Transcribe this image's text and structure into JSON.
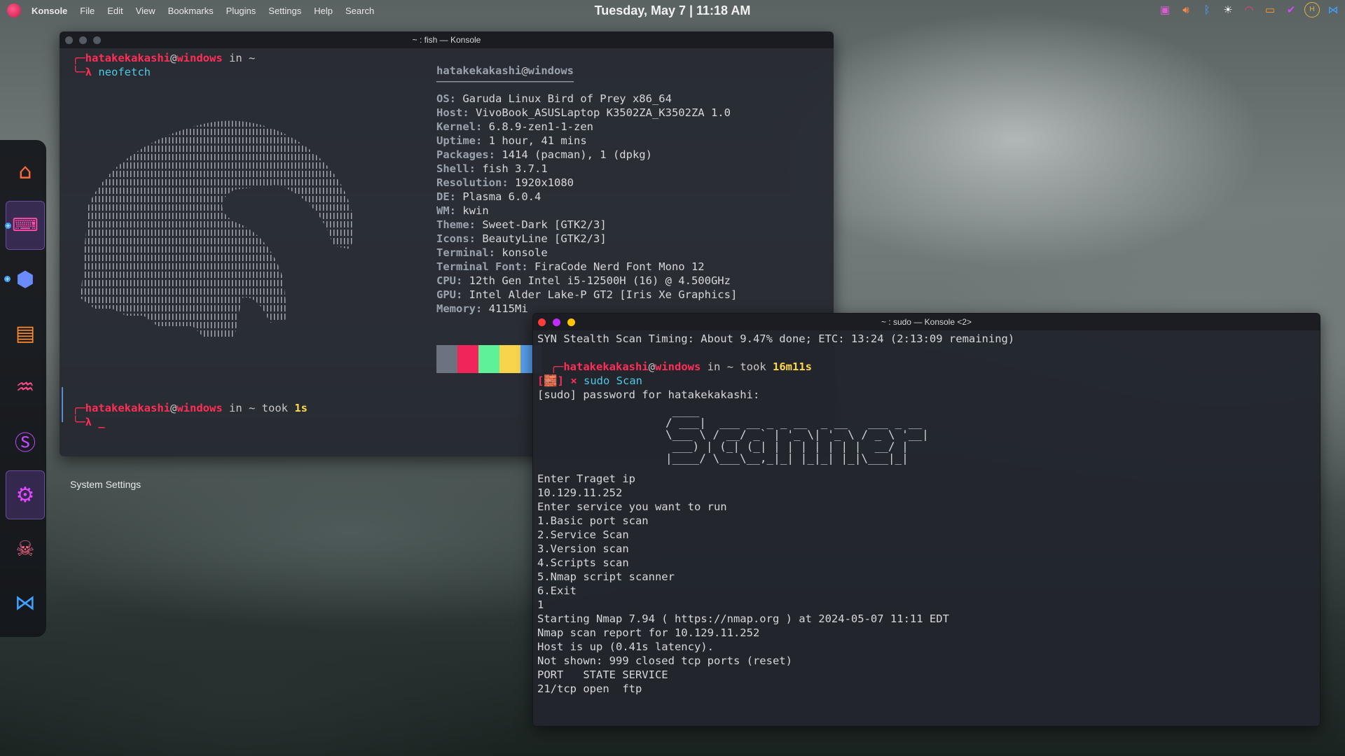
{
  "topbar": {
    "app_name": "Konsole",
    "menu": [
      "File",
      "Edit",
      "View",
      "Bookmarks",
      "Plugins",
      "Settings",
      "Help",
      "Search"
    ],
    "clock": "Tuesday, May 7 | 11:18 AM",
    "tray_icons": [
      "calendar-icon",
      "volume-icon",
      "bluetooth-icon",
      "brightness-icon",
      "wifi-icon",
      "battery-icon",
      "vivaldi-icon",
      "user-avatar-icon",
      "vscode-icon"
    ],
    "avatar_letter": "H"
  },
  "dock": {
    "items": [
      "garuda-icon",
      "konsole-icon",
      "browser-icon",
      "files-icon",
      "system-monitor-icon",
      "snap-icon",
      "settings-icon",
      "ghost-icon",
      "vscode-icon"
    ],
    "tooltip": "System Settings"
  },
  "window1": {
    "title": "~ : fish — Konsole",
    "prompt_user": "hatakekakashi",
    "prompt_at": "@",
    "prompt_host": "windows",
    "prompt_in": " in ",
    "prompt_dir": "~",
    "command": "neofetch",
    "lambda": "λ",
    "header_user": "hatakekakashi",
    "header_at": "@",
    "header_host": "windows",
    "separator": "─────────────────────",
    "info": [
      {
        "label": "OS",
        "value": "Garuda Linux Bird of Prey x86_64"
      },
      {
        "label": "Host",
        "value": "VivoBook_ASUSLaptop K3502ZA_K3502ZA 1.0"
      },
      {
        "label": "Kernel",
        "value": "6.8.9-zen1-1-zen"
      },
      {
        "label": "Uptime",
        "value": "1 hour, 41 mins"
      },
      {
        "label": "Packages",
        "value": "1414 (pacman), 1 (dpkg)"
      },
      {
        "label": "Shell",
        "value": "fish 3.7.1"
      },
      {
        "label": "Resolution",
        "value": "1920x1080"
      },
      {
        "label": "DE",
        "value": "Plasma 6.0.4"
      },
      {
        "label": "WM",
        "value": "kwin"
      },
      {
        "label": "Theme",
        "value": "Sweet-Dark [GTK2/3]"
      },
      {
        "label": "Icons",
        "value": "BeautyLine [GTK2/3]"
      },
      {
        "label": "Terminal",
        "value": "konsole"
      },
      {
        "label": "Terminal Font",
        "value": "FiraCode Nerd Font Mono 12"
      },
      {
        "label": "CPU",
        "value": "12th Gen Intel i5-12500H (16) @ 4.500GHz"
      },
      {
        "label": "GPU",
        "value": "Intel Alder Lake-P GT2 [Iris Xe Graphics]"
      },
      {
        "label": "Memory",
        "value": "4115Mi"
      }
    ],
    "swatch_colors": [
      "#6b7280",
      "#f0265b",
      "#5ff09a",
      "#f7d44c",
      "#5aa0f0"
    ],
    "prompt2_took": " took ",
    "prompt2_time": "1s",
    "cursor_line": "λ _"
  },
  "window2": {
    "title": "~ : sudo — Konsole <2>",
    "lines_top": "SYN Stealth Scan Timing: About 9.47% done; ETC: 13:24 (2:13:09 remaining)",
    "prompt_user": "hatakekakashi",
    "prompt_at": "@",
    "prompt_host": "windows",
    "prompt_in": " in ",
    "prompt_dir": "~",
    "prompt_took": " took ",
    "prompt_time": "16m11s",
    "status_glyph": "[🧱]",
    "status_x": "×",
    "sudo_cmd": "sudo",
    "scan_cmd": "Scan",
    "sudo_prompt": "[sudo] password for hatakekakashi:",
    "banner": "                    ____\n                   / ___|  ___ __ _ _ __  _ __   ___ _ __\n                   \\___ \\ / __/ _` | '_ \\| '_ \\ / _ \\ '__|\n                    ___) | (_| (_| | | | | | | |  __/ |\n                   |____/ \\___\\__,_|_| |_|_| |_|\\___|_|",
    "output": [
      "Enter Traget ip",
      "10.129.11.252",
      "Enter service you want to run",
      "1.Basic port scan",
      "2.Service Scan",
      "3.Version scan",
      "4.Scripts scan",
      "5.Nmap script scanner",
      "6.Exit",
      "1",
      "Starting Nmap 7.94 ( https://nmap.org ) at 2024-05-07 11:11 EDT",
      "Nmap scan report for 10.129.11.252",
      "Host is up (0.41s latency).",
      "Not shown: 999 closed tcp ports (reset)",
      "PORT   STATE SERVICE",
      "21/tcp open  ftp"
    ]
  }
}
